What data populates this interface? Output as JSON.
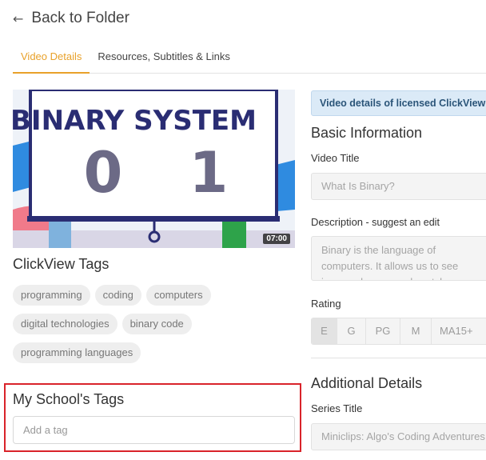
{
  "nav": {
    "back_arrow": "←",
    "back_label": "Back to Folder"
  },
  "tabs": [
    {
      "label": "Video Details",
      "active": true
    },
    {
      "label": "Resources, Subtitles & Links",
      "active": false
    }
  ],
  "video": {
    "thumbnail_title": "BINARY SYSTEM",
    "digit_left": "0",
    "digit_right": "1",
    "duration": "07:00"
  },
  "clickview_tags": {
    "title": "ClickView Tags",
    "items": [
      "programming",
      "coding",
      "computers",
      "digital technologies",
      "binary code",
      "programming languages"
    ]
  },
  "school_tags": {
    "title": "My School's Tags",
    "placeholder": "Add a tag"
  },
  "banner": "Video details of licensed ClickView",
  "basic_info": {
    "heading": "Basic Information",
    "video_title_label": "Video Title",
    "video_title_value": "What Is Binary?",
    "description_label": "Description",
    "description_hint": " - suggest an edit",
    "description_value": "Binary is the language of computers. It allows us to see images, hear sound, watch",
    "rating_label": "Rating",
    "ratings": [
      "E",
      "G",
      "PG",
      "M",
      "MA15+"
    ],
    "selected_rating": "E"
  },
  "additional": {
    "heading": "Additional Details",
    "series_label": "Series Title",
    "series_value": "Miniclips: Algo's Coding Adventures"
  },
  "colors": {
    "accent": "#e8a12a",
    "highlight_border": "#d9232a",
    "banner_bg": "#dbeaf7",
    "thumb_text": "#2a2d73"
  }
}
